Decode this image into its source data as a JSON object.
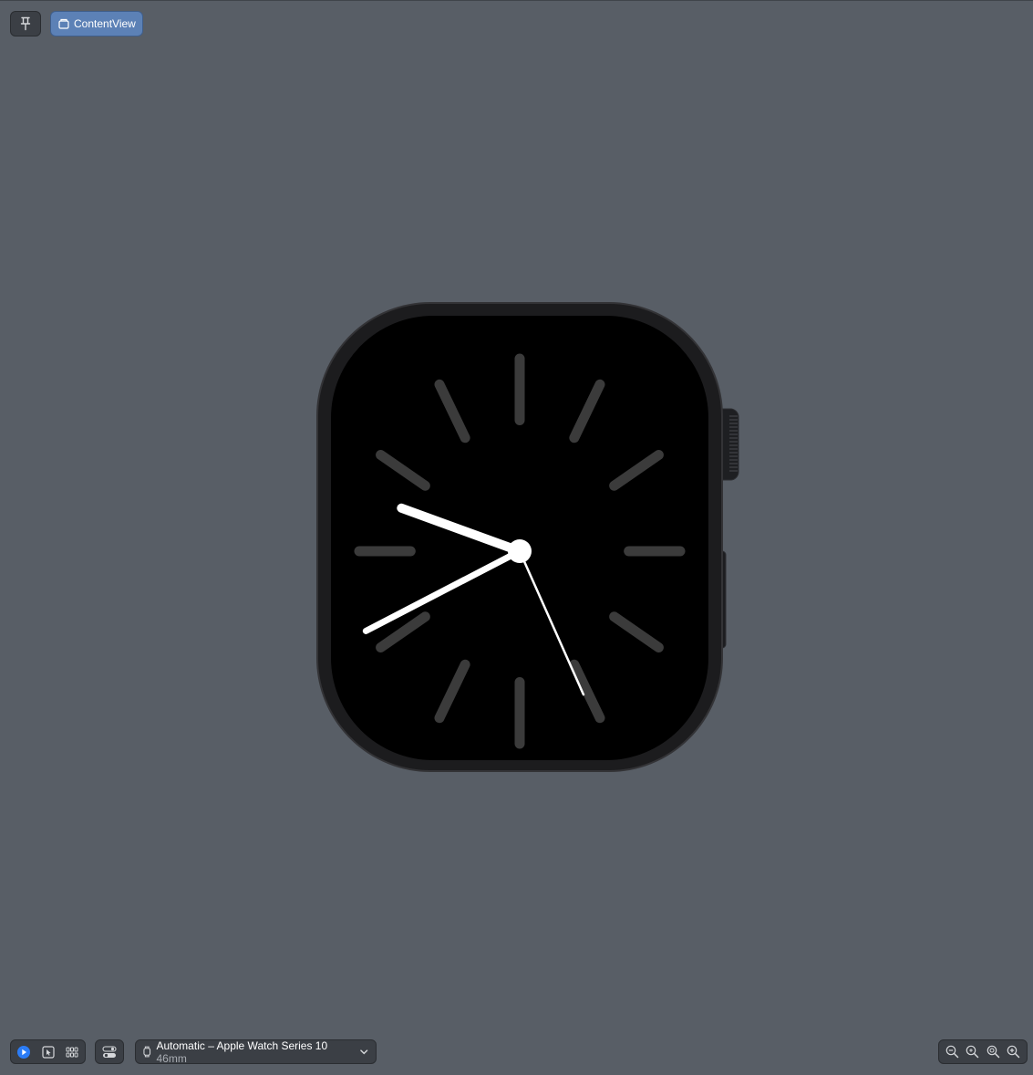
{
  "toolbar_top": {
    "pin_icon": "pin-icon",
    "tab": {
      "label": "ContentView",
      "icon": "window-icon"
    }
  },
  "watch": {
    "device": "Apple Watch Series 10 46mm",
    "face": {
      "hour_markers": 12,
      "time": {
        "hour": 9,
        "minute": 40,
        "second": 26
      },
      "colors": {
        "screen": "#000000",
        "markers": "#3b3b3b",
        "hands": "#ffffff",
        "case": "#1c1c1e"
      }
    }
  },
  "toolbar_bottom": {
    "modes": [
      "live-icon",
      "selectable-icon",
      "variants-grid-icon"
    ],
    "active_mode": "live-icon",
    "device_settings_icon": "toggle-settings-icon",
    "device_select": {
      "label": "Automatic – Apple Watch Series 10",
      "size": "46mm",
      "icon": "watch-icon",
      "chevron": "chevron-down-icon"
    },
    "zoom": [
      "zoom-out-icon",
      "zoom-fit-icon",
      "zoom-actual-icon",
      "zoom-in-icon"
    ]
  }
}
